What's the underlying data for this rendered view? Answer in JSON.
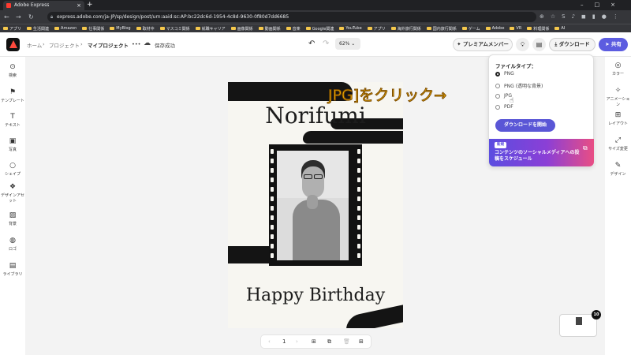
{
  "browser": {
    "tab_title": "Adobe Express",
    "url": "express.adobe.com/ja-JP/sp/design/post/urn:aaid:sc:AP:bc22dc6d-1954-4c8d-9630-0f80d7dd6685",
    "bookmarks": [
      "アプリ",
      "生活関連",
      "Amazon",
      "仕事関係",
      "MyBlog",
      "取材中",
      "マスコミ関係",
      "就職キャリア",
      "画像関係",
      "動画関係",
      "音楽",
      "Google関連",
      "YouTube",
      "アプリ",
      "海外旅行関係",
      "国内旅行関係",
      "ゲーム",
      "Adobe",
      "VR",
      "料理関係",
      "AI"
    ]
  },
  "header": {
    "breadcrumb_home": "ホーム",
    "breadcrumb_project": "プロジェクト",
    "breadcrumb_current": "マイプロジェクト",
    "more": "•••",
    "save_status": "保存成功",
    "zoom": "62%",
    "premium_label": "プレミアムメンバー",
    "download_label": "ダウンロード",
    "share_label": "共有"
  },
  "left_rail": [
    "検索",
    "テンプレート",
    "テキスト",
    "写真",
    "シェイプ",
    "デザインアセット",
    "背景",
    "ロゴ",
    "ライブラリ"
  ],
  "right_rail": [
    "カラー",
    "アニメーション",
    "レイアウト",
    "サイズ変更",
    "デザイン"
  ],
  "canvas": {
    "name": "Norifumi",
    "greeting": "Happy Birthday"
  },
  "pagebar": {
    "page_number": "1"
  },
  "thumbnail_badge": "10",
  "download_panel": {
    "title": "ファイルタイプ：",
    "options": [
      "PNG",
      "PNG (透明な背景)",
      "JPG",
      "PDF"
    ],
    "selected_index": 0,
    "start_button": "ダウンロードを開始",
    "promo_badge": "新規",
    "promo_text": "コンテンツのソーシャルメディアへの投稿をスケジュール"
  },
  "annotation": {
    "callout": "JPG]をクリック→"
  },
  "colors": {
    "accent": "#5c5ce0",
    "callout": "#f7b500"
  }
}
